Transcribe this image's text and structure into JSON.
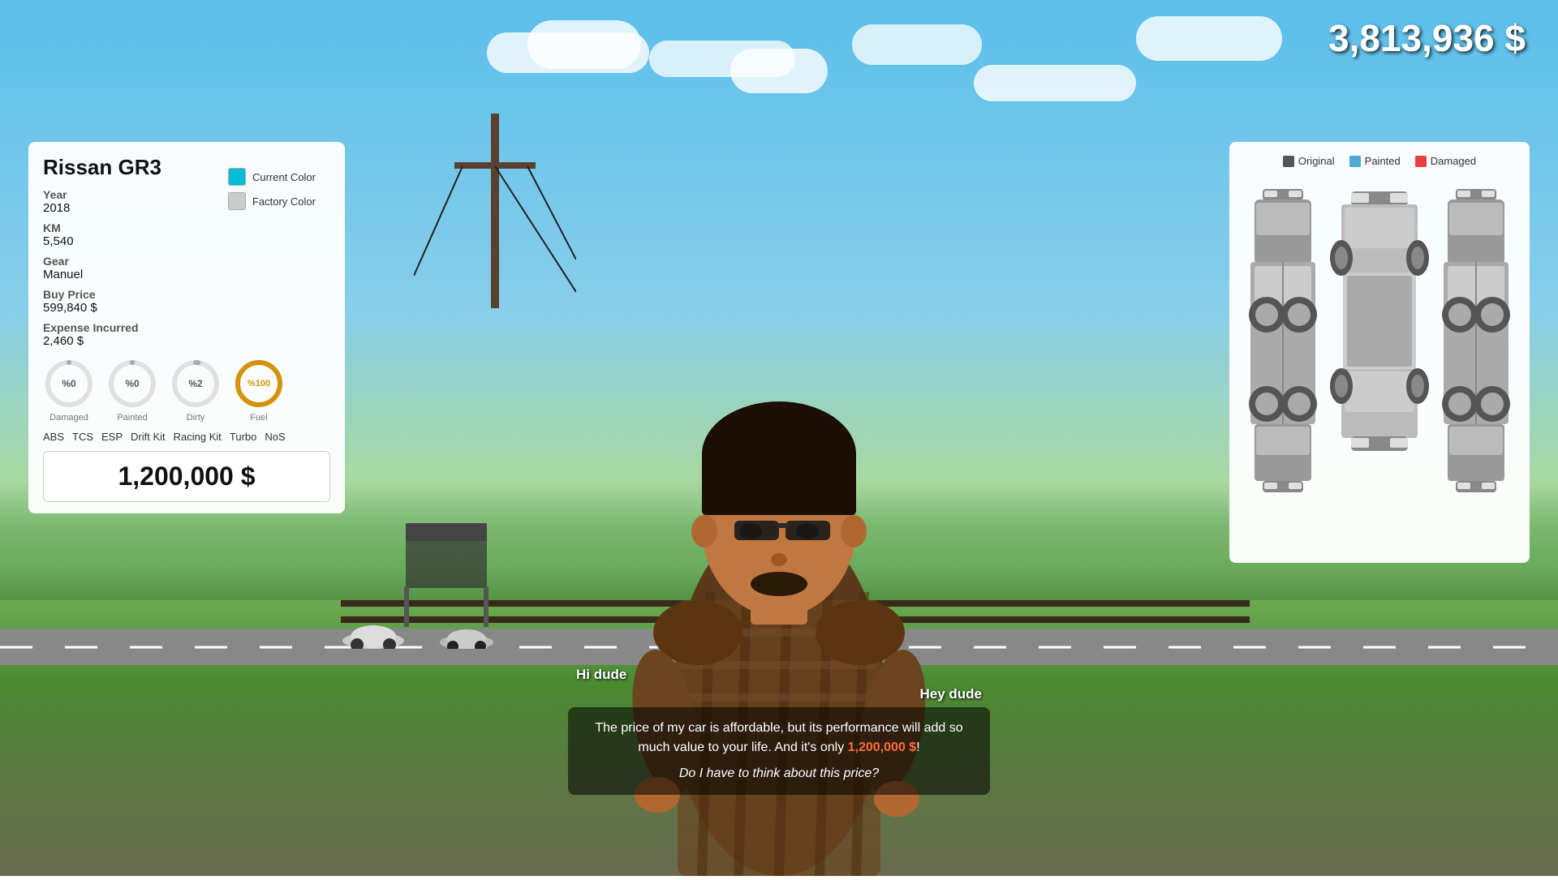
{
  "currency": {
    "balance": "3,813,936 $"
  },
  "car_info": {
    "title": "Rissan GR3",
    "color_current_label": "Current Color",
    "color_factory_label": "Factory Color",
    "current_color": "#00bcd4",
    "factory_color": "#cccccc",
    "year_label": "Year",
    "year_value": "2018",
    "km_label": "KM",
    "km_value": "5,540",
    "gear_label": "Gear",
    "gear_value": "Manuel",
    "buy_price_label": "Buy Price",
    "buy_price_value": "599,840 $",
    "expense_label": "Expense Incurred",
    "expense_value": "2,460 $",
    "gauges": [
      {
        "id": "damaged",
        "label": "Damaged",
        "value": "0",
        "display": "%0",
        "color": "#aaa",
        "percent": 0
      },
      {
        "id": "painted",
        "label": "Painted",
        "value": "0",
        "display": "%0",
        "color": "#aaa",
        "percent": 0
      },
      {
        "id": "dirty",
        "label": "Dirty",
        "value": "2",
        "display": "%2",
        "color": "#aaa",
        "percent": 2
      },
      {
        "id": "fuel",
        "label": "Fuel",
        "value": "100",
        "display": "%100",
        "color": "#d4930a",
        "percent": 100
      }
    ],
    "features": [
      "ABS",
      "TCS",
      "ESP",
      "Drift Kit",
      "Racing Kit",
      "Turbo",
      "NoS"
    ],
    "sell_price": "1,200,000 $"
  },
  "car_diagram": {
    "legend": [
      {
        "label": "Original",
        "color": "#555"
      },
      {
        "label": "Painted",
        "color": "#4fa8d5"
      },
      {
        "label": "Damaged",
        "color": "#e84040"
      }
    ]
  },
  "dialogue": {
    "player_line": "Hi dude",
    "npc_name": "Hey dude",
    "npc_text": "The price of my car is affordable, but its performance will add so much value to your life. And it's only 1,200,000 $!",
    "highlight_price": "1,200,000 $",
    "question": "Do I have to think about this price?"
  }
}
